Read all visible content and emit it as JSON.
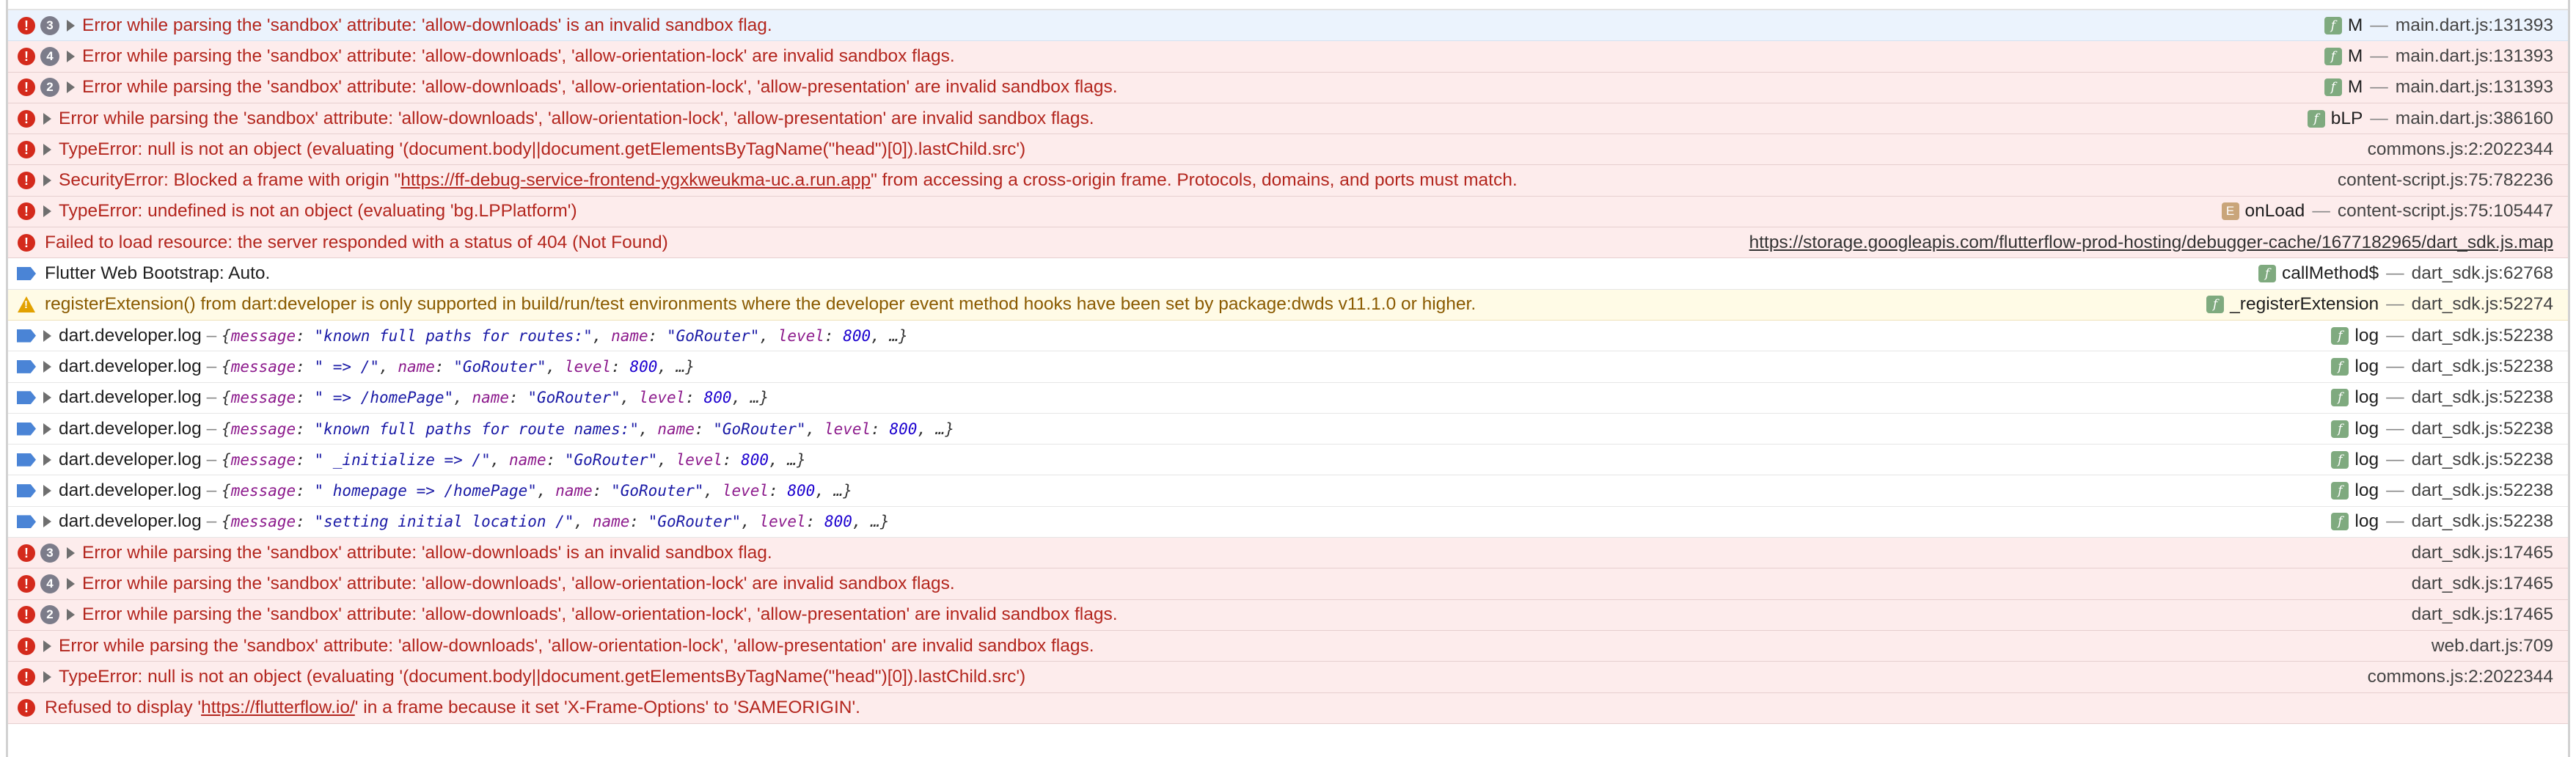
{
  "console": {
    "rows": [
      {
        "kind": "error",
        "selected": true,
        "count": "3",
        "expand": true,
        "parts": [
          {
            "t": "Error while parsing the 'sandbox' attribute: 'allow-downloads' is an invalid sandbox flag."
          }
        ],
        "fn": "M",
        "badge": "f",
        "file": "main.dart.js:131393"
      },
      {
        "kind": "error",
        "count": "4",
        "expand": true,
        "parts": [
          {
            "t": "Error while parsing the 'sandbox' attribute: 'allow-downloads', 'allow-orientation-lock' are invalid sandbox flags."
          }
        ],
        "fn": "M",
        "badge": "f",
        "file": "main.dart.js:131393"
      },
      {
        "kind": "error",
        "count": "2",
        "expand": true,
        "parts": [
          {
            "t": "Error while parsing the 'sandbox' attribute: 'allow-downloads', 'allow-orientation-lock', 'allow-presentation' are invalid sandbox flags."
          }
        ],
        "fn": "M",
        "badge": "f",
        "file": "main.dart.js:131393"
      },
      {
        "kind": "error",
        "expand": true,
        "parts": [
          {
            "t": "Error while parsing the 'sandbox' attribute: 'allow-downloads', 'allow-orientation-lock', 'allow-presentation' are invalid sandbox flags."
          }
        ],
        "fn": "bLP",
        "badge": "f",
        "file": "main.dart.js:386160"
      },
      {
        "kind": "error",
        "expand": true,
        "parts": [
          {
            "t": "TypeError: null is not an object (evaluating '(document.body||document.getElementsByTagName(\"head\")[0]).lastChild.src')"
          }
        ],
        "file": "commons.js:2:2022344"
      },
      {
        "kind": "error",
        "expand": true,
        "parts": [
          {
            "t": "SecurityError: Blocked a frame with origin \""
          },
          {
            "t": "https://ff-debug-service-frontend-ygxkweukma-uc.a.run.app",
            "u": true
          },
          {
            "t": "\" from accessing a cross-origin frame. Protocols, domains, and ports must match."
          }
        ],
        "file": "content-script.js:75:782236"
      },
      {
        "kind": "error",
        "expand": true,
        "parts": [
          {
            "t": "TypeError: undefined is not an object (evaluating 'bg.LPPlatform')"
          }
        ],
        "fn": "onLoad",
        "badge": "E",
        "file": "content-script.js:75:105447"
      },
      {
        "kind": "error",
        "parts": [
          {
            "t": "Failed to load resource: the server responded with a status of 404 (Not Found)"
          }
        ],
        "file": "https://storage.googleapis.com/flutterflow-prod-hosting/debugger-cache/1677182965/dart_sdk.js.map",
        "link": true
      },
      {
        "kind": "info",
        "parts": [
          {
            "t": "Flutter Web Bootstrap: Auto."
          }
        ],
        "fn": "callMethod$",
        "badge": "f",
        "file": "dart_sdk.js:62768"
      },
      {
        "kind": "warn",
        "parts": [
          {
            "t": "registerExtension() from dart:developer is only supported in build/run/test environments where the developer event method hooks have been set by package:dwds v11.1.0 or higher."
          }
        ],
        "fn": "_registerExtension",
        "badge": "f",
        "file": "dart_sdk.js:52274"
      },
      {
        "kind": "log",
        "expand": true,
        "name": "dart.developer.log",
        "obj": {
          "message": "\"known full paths for routes:\"",
          "name": "\"GoRouter\"",
          "level": "800"
        },
        "fn": "log",
        "badge": "f",
        "file": "dart_sdk.js:52238"
      },
      {
        "kind": "log",
        "expand": true,
        "name": "dart.developer.log",
        "obj": {
          "message": "\"  => /\"",
          "name": "\"GoRouter\"",
          "level": "800"
        },
        "fn": "log",
        "badge": "f",
        "file": "dart_sdk.js:52238"
      },
      {
        "kind": "log",
        "expand": true,
        "name": "dart.developer.log",
        "obj": {
          "message": "\"  =>   /homePage\"",
          "name": "\"GoRouter\"",
          "level": "800"
        },
        "fn": "log",
        "badge": "f",
        "file": "dart_sdk.js:52238"
      },
      {
        "kind": "log",
        "expand": true,
        "name": "dart.developer.log",
        "obj": {
          "message": "\"known full paths for route names:\"",
          "name": "\"GoRouter\"",
          "level": "800"
        },
        "fn": "log",
        "badge": "f",
        "file": "dart_sdk.js:52238"
      },
      {
        "kind": "log",
        "expand": true,
        "name": "dart.developer.log",
        "obj": {
          "message": "\"  _initialize => /\"",
          "name": "\"GoRouter\"",
          "level": "800"
        },
        "fn": "log",
        "badge": "f",
        "file": "dart_sdk.js:52238"
      },
      {
        "kind": "log",
        "expand": true,
        "name": "dart.developer.log",
        "obj": {
          "message": "\"  homepage => /homePage\"",
          "name": "\"GoRouter\"",
          "level": "800"
        },
        "fn": "log",
        "badge": "f",
        "file": "dart_sdk.js:52238"
      },
      {
        "kind": "log",
        "expand": true,
        "name": "dart.developer.log",
        "obj": {
          "message": "\"setting initial location /\"",
          "name": "\"GoRouter\"",
          "level": "800"
        },
        "fn": "log",
        "badge": "f",
        "file": "dart_sdk.js:52238"
      },
      {
        "kind": "error",
        "count": "3",
        "expand": true,
        "parts": [
          {
            "t": "Error while parsing the 'sandbox' attribute: 'allow-downloads' is an invalid sandbox flag."
          }
        ],
        "file": "dart_sdk.js:17465"
      },
      {
        "kind": "error",
        "count": "4",
        "expand": true,
        "parts": [
          {
            "t": "Error while parsing the 'sandbox' attribute: 'allow-downloads', 'allow-orientation-lock' are invalid sandbox flags."
          }
        ],
        "file": "dart_sdk.js:17465"
      },
      {
        "kind": "error",
        "count": "2",
        "expand": true,
        "parts": [
          {
            "t": "Error while parsing the 'sandbox' attribute: 'allow-downloads', 'allow-orientation-lock', 'allow-presentation' are invalid sandbox flags."
          }
        ],
        "file": "dart_sdk.js:17465"
      },
      {
        "kind": "error",
        "expand": true,
        "parts": [
          {
            "t": "Error while parsing the 'sandbox' attribute: 'allow-downloads', 'allow-orientation-lock', 'allow-presentation' are invalid sandbox flags."
          }
        ],
        "file": "web.dart.js:709"
      },
      {
        "kind": "error",
        "expand": true,
        "parts": [
          {
            "t": "TypeError: null is not an object (evaluating '(document.body||document.getElementsByTagName(\"head\")[0]).lastChild.src')"
          }
        ],
        "file": "commons.js:2:2022344"
      },
      {
        "kind": "error",
        "parts": [
          {
            "t": "Refused to display '"
          },
          {
            "t": "https://flutterflow.io/",
            "u": true
          },
          {
            "t": "' in a frame because it set 'X-Frame-Options' to 'SAMEORIGIN'."
          }
        ]
      }
    ]
  }
}
